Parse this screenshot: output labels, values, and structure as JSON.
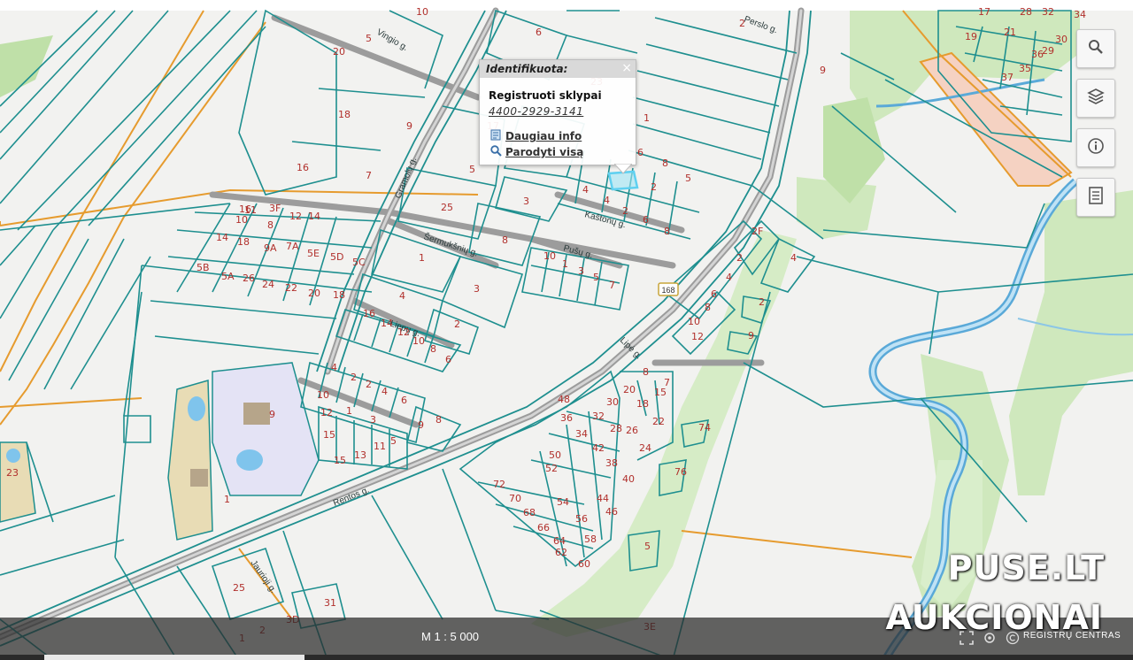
{
  "popup": {
    "header": "Identifikuota:",
    "close_glyph": "×",
    "title": "Registruoti sklypai",
    "code": "4400-2929-3141",
    "more_info": "Daugiau info",
    "show_all": "Parodyti visą"
  },
  "toolbar": {
    "search_icon": "search-icon",
    "layers_icon": "layers-icon",
    "info_icon": "info-icon",
    "legend_icon": "legend-icon"
  },
  "bottom_bar": {
    "scale": "M 1 : 5 000",
    "registras": "REGISTRŲ CENTRAS"
  },
  "watermark": {
    "line1": "PUSE.LT",
    "line2": "AUKCIONAI"
  },
  "video_progress": 0.23,
  "map": {
    "streets": [
      "Vingio g.",
      "Gramolų g.",
      "Šermukšnių g.",
      "Kaštonų g.",
      "Pušų g.",
      "Liepų g.",
      "Lipė g.",
      "Rentos g.",
      "Jaurioji g.",
      "Perslo g."
    ],
    "road_shield": "168",
    "parcel_numbers": [
      "10",
      "5",
      "6",
      "2",
      "20",
      "18",
      "9",
      "16",
      "7",
      "5",
      "25",
      "3",
      "8",
      "1",
      "4",
      "3",
      "2",
      "1",
      "17",
      "23",
      "2",
      "5",
      "8",
      "6",
      "4",
      "2",
      "4",
      "6",
      "8",
      "10",
      "1",
      "3",
      "5",
      "7",
      "9",
      "2F",
      "2",
      "4",
      "6",
      "8",
      "10",
      "12",
      "2",
      "9",
      "4",
      "8",
      "15",
      "18",
      "20",
      "22",
      "24",
      "26",
      "28",
      "30",
      "32",
      "34",
      "36",
      "38",
      "40",
      "42",
      "44",
      "46",
      "48",
      "50",
      "52",
      "54",
      "56",
      "58",
      "60",
      "62",
      "64",
      "66",
      "68",
      "70",
      "72",
      "74",
      "76",
      "5",
      "7",
      "9",
      "1",
      "23",
      "25",
      "31",
      "1",
      "2",
      "3D",
      "3E",
      "3F",
      "11",
      "12",
      "14",
      "10",
      "8",
      "16",
      "14",
      "18",
      "9A",
      "7A",
      "5E",
      "5D",
      "5C",
      "5B",
      "5A",
      "26",
      "24",
      "22",
      "20",
      "18",
      "16",
      "14",
      "12",
      "10",
      "8",
      "6",
      "4",
      "2",
      "2",
      "4",
      "6",
      "8",
      "10",
      "12",
      "15",
      "1",
      "3",
      "5",
      "9",
      "11",
      "13",
      "15",
      "17",
      "19",
      "21",
      "28",
      "30",
      "32",
      "34",
      "35",
      "36",
      "37",
      "29",
      "31",
      "27",
      "33"
    ]
  },
  "colors": {
    "parcel_line": "#1e8f8f",
    "road": "#9a9a9a",
    "orange_line": "#e69b2e",
    "green_area": "#c9e6b4",
    "river": "#5aa9d8",
    "label_red": "#b1302c",
    "highlight": "#5fd0f0"
  }
}
